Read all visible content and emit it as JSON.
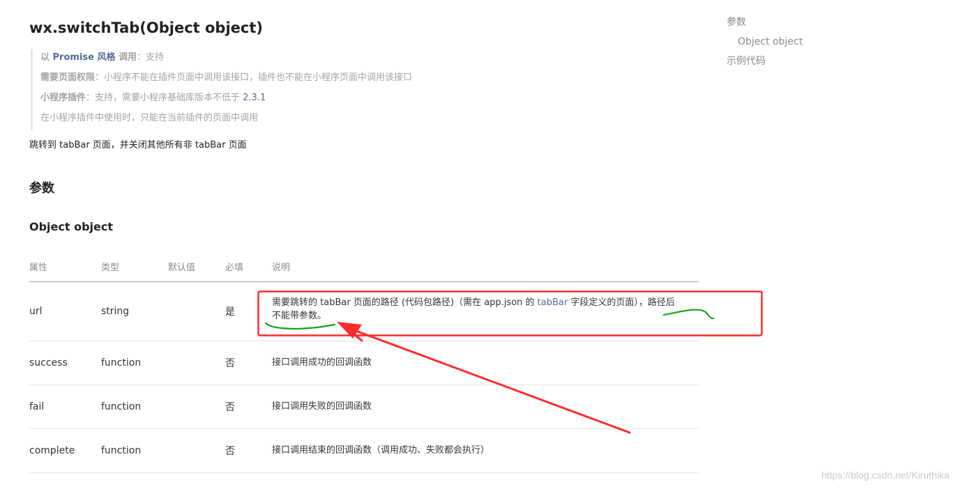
{
  "api": {
    "title": "wx.switchTab(Object object)"
  },
  "notice": {
    "promise_prefix": "以 ",
    "promise_link": "Promise 风格",
    "promise_mid": " 调用",
    "promise_value": "：支持",
    "perm_label": "需要页面权限",
    "perm_value": "：小程序不能在插件页面中调用该接口，插件也不能在小程序页面中调用该接口",
    "plugin_label": "小程序插件",
    "plugin_value": "：支持，需要小程序基础库版本不低于 ",
    "plugin_version": "2.3.1",
    "plugin_note": "在小程序插件中使用时，只能在当前插件的页面中调用"
  },
  "description": "跳转到 tabBar 页面，并关闭其他所有非 tabBar 页面",
  "headings": {
    "params": "参数",
    "object": "Object object"
  },
  "table": {
    "headers": [
      "属性",
      "类型",
      "默认值",
      "必填",
      "说明"
    ],
    "rows": [
      {
        "name": "url",
        "type": "string",
        "default": "",
        "required": "是",
        "desc_1": "需要跳转的 tabBar 页面的路径 (代码包路径)（需在 app.json 的 ",
        "desc_link": "tabBar",
        "desc_2": " 字段定义的页面），路径后不能带参数。"
      },
      {
        "name": "success",
        "type": "function",
        "default": "",
        "required": "否",
        "desc": "接口调用成功的回调函数"
      },
      {
        "name": "fail",
        "type": "function",
        "default": "",
        "required": "否",
        "desc": "接口调用失败的回调函数"
      },
      {
        "name": "complete",
        "type": "function",
        "default": "",
        "required": "否",
        "desc": "接口调用结束的回调函数（调用成功、失败都会执行）"
      }
    ]
  },
  "toc": {
    "items": [
      "参数",
      "Object object",
      "示例代码"
    ]
  },
  "annotation": {
    "box_color": "#ff2a2a",
    "arrow_color": "#ff2a2a",
    "underline_color": "#1aa31a"
  },
  "colors": {
    "link": "#576b95"
  },
  "watermark": "https://blog.csdn.net/Kiruthika"
}
